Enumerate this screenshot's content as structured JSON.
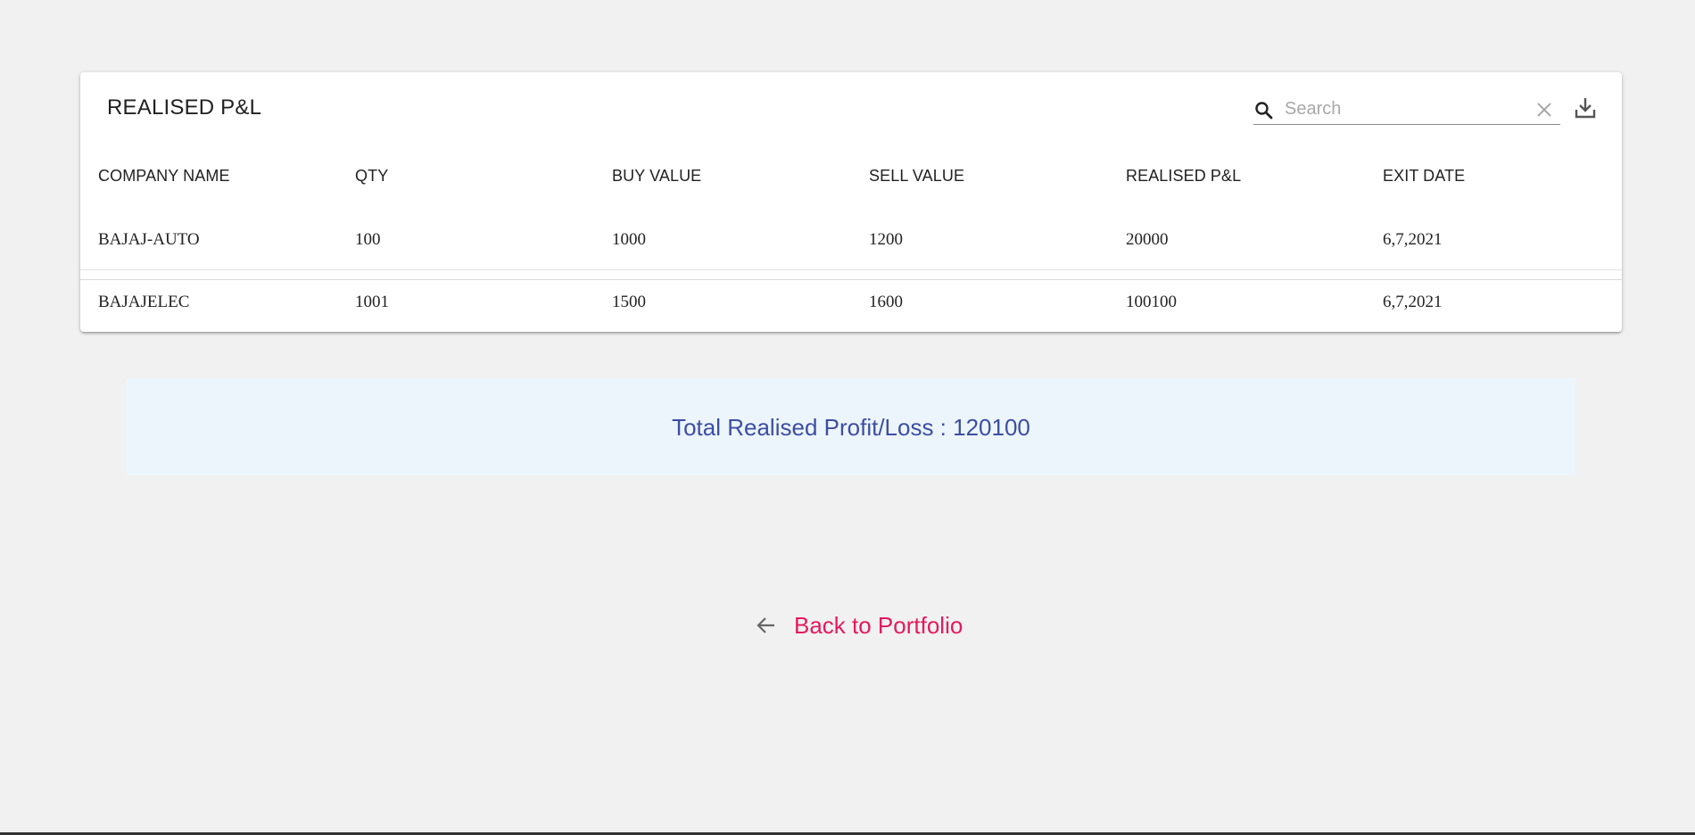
{
  "card": {
    "title": "REALISED P&L",
    "search_placeholder": "Search",
    "columns": [
      "COMPANY NAME",
      "QTY",
      "BUY VALUE",
      "SELL VALUE",
      "REALISED P&L",
      "EXIT DATE"
    ],
    "rows": [
      [
        "BAJAJ-AUTO",
        "100",
        "1000",
        "1200",
        "20000",
        "6,7,2021"
      ],
      [
        "BAJAJELEC",
        "1001",
        "1500",
        "1600",
        "100100",
        "6,7,2021"
      ]
    ]
  },
  "summary": {
    "text": "Total Realised Profit/Loss : 120100"
  },
  "back": {
    "label": "Back to Portfolio"
  },
  "icons": {
    "search": "search-icon",
    "clear": "close-icon",
    "download": "download-icon",
    "back": "arrow-left-icon"
  },
  "colors": {
    "background": "#f1f1f1",
    "summary_bg": "#edf5fc",
    "summary_text": "#3c4ea3",
    "link": "#e5195e"
  }
}
